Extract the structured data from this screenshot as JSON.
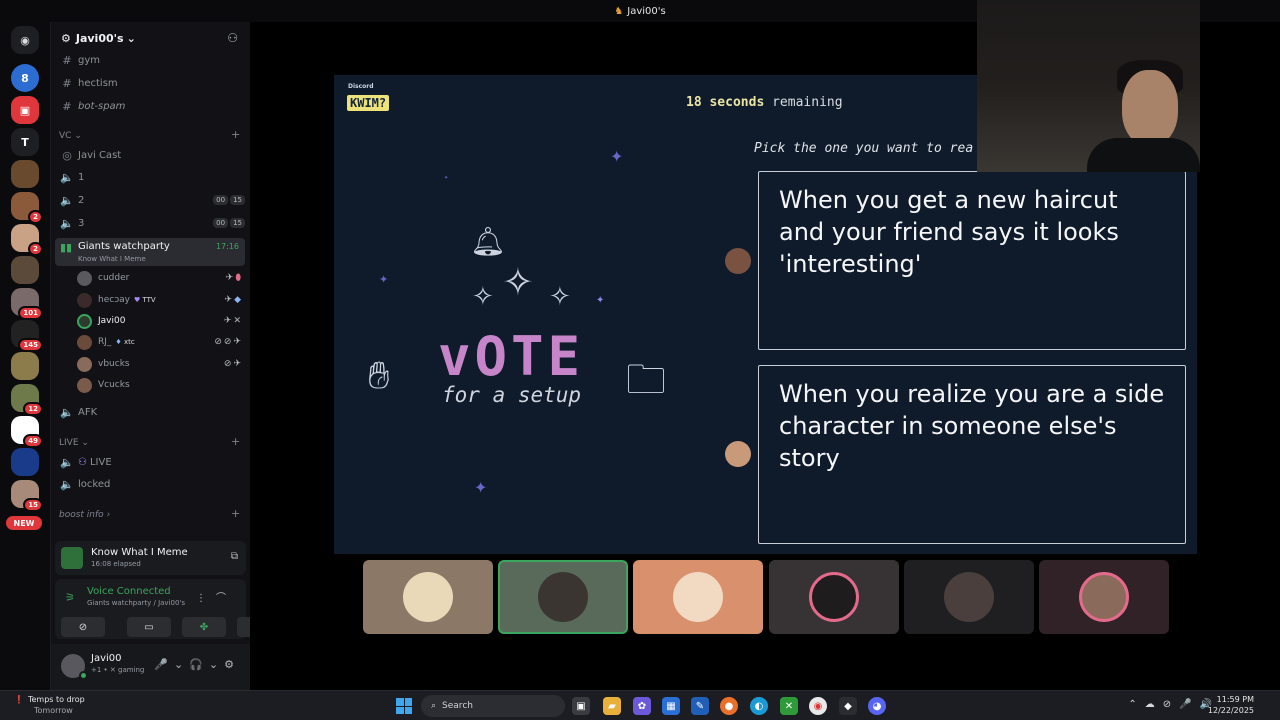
{
  "window": {
    "title": "Javi00's"
  },
  "servers": [
    {
      "label": "",
      "badge": ""
    },
    {
      "label": "",
      "badge": ""
    },
    {
      "label": "T",
      "badge": ""
    },
    {
      "label": "",
      "badge": ""
    },
    {
      "label": "",
      "badge": "2"
    },
    {
      "label": "",
      "badge": "2"
    },
    {
      "label": "",
      "badge": ""
    },
    {
      "label": "",
      "badge": "101"
    },
    {
      "label": "",
      "badge": "145"
    },
    {
      "label": "",
      "badge": ""
    },
    {
      "label": "",
      "badge": "12"
    },
    {
      "label": "",
      "badge": "49"
    },
    {
      "label": "",
      "badge": ""
    },
    {
      "label": "",
      "badge": "15"
    }
  ],
  "new_label": "NEW",
  "server": {
    "name": "Javi00's"
  },
  "channels": {
    "text": [
      "gym",
      "hectism",
      "bot-spam"
    ],
    "vc_category": "VC",
    "voice": [
      {
        "name": "Javi Cast"
      },
      {
        "name": "1"
      },
      {
        "name": "2",
        "count": "00",
        "limit": "15"
      },
      {
        "name": "3",
        "count": "00",
        "limit": "15"
      }
    ],
    "active": {
      "name": "Giants watchparty",
      "activity": "Know What I Meme",
      "time": "17:16"
    },
    "members": [
      {
        "name": "cudder",
        "tag": ""
      },
      {
        "name": "hecɔay",
        "tag": "TTV"
      },
      {
        "name": "Javi00",
        "tag": ""
      },
      {
        "name": "RJ_",
        "tag": "xtc"
      },
      {
        "name": "vbucks",
        "tag": ""
      },
      {
        "name": "Vcucks",
        "tag": ""
      }
    ],
    "afk": "AFK",
    "live_category": "LIVE",
    "live": [
      {
        "name": "LIVE"
      },
      {
        "name": "locked"
      }
    ],
    "boost": "boost info"
  },
  "activity": {
    "title": "Know What I Meme",
    "elapsed": "16:08 elapsed"
  },
  "voice_status": {
    "status": "Voice Connected",
    "location": "Giants watchparty / Javi00's"
  },
  "user": {
    "name": "Javi00",
    "status": "gaming"
  },
  "game": {
    "brand": "Discord",
    "logo": "KWIM?",
    "timer_number": "18 seconds",
    "timer_rest": " remaining",
    "prompt": "Pick the one you want to rea",
    "vote_title": "vOTE",
    "vote_subtitle": "for a setup",
    "options": [
      {
        "text": "When you get a new haircut and your friend says it looks 'interesting'"
      },
      {
        "text": "When you realize you are a side character in someone else's story"
      }
    ]
  },
  "taskbar": {
    "weather_title": "Temps to drop",
    "weather_sub": "Tomorrow",
    "search_placeholder": "Search",
    "time": "11:59 PM",
    "date": "12/22/2025"
  },
  "colors": {
    "accent_green": "#3ba55d",
    "badge_red": "#e0373d",
    "game_bg": "#0f1b2b",
    "vote_purple": "#c785c9"
  }
}
